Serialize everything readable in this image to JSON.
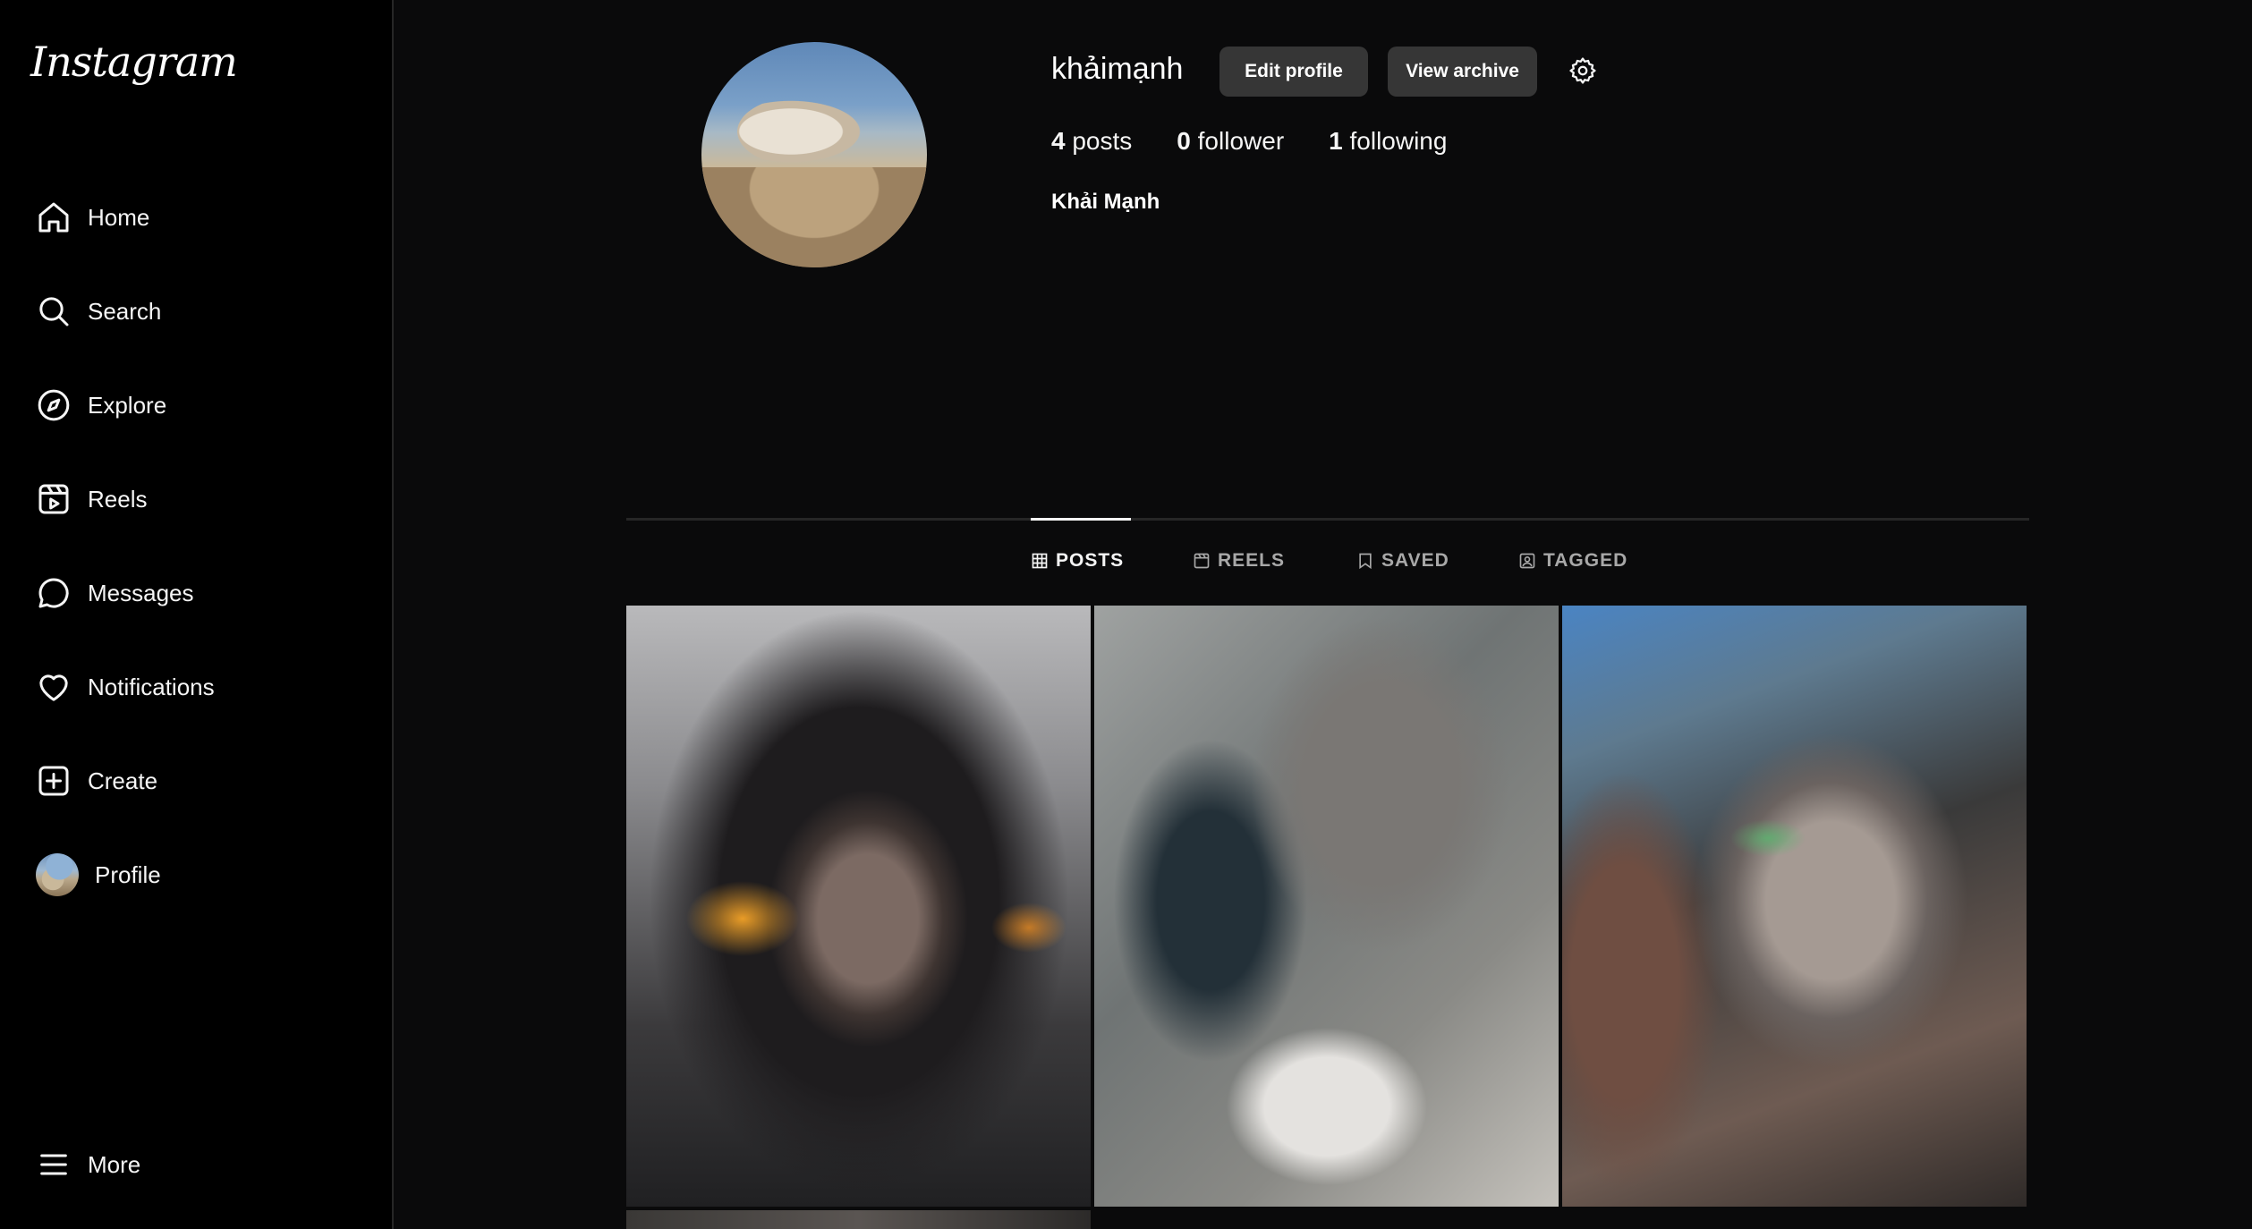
{
  "app": {
    "logo_text": "Instagram"
  },
  "sidebar": {
    "items": [
      {
        "label": "Home",
        "icon": "home-icon"
      },
      {
        "label": "Search",
        "icon": "search-icon"
      },
      {
        "label": "Explore",
        "icon": "compass-icon"
      },
      {
        "label": "Reels",
        "icon": "reels-icon"
      },
      {
        "label": "Messages",
        "icon": "message-icon"
      },
      {
        "label": "Notifications",
        "icon": "heart-icon"
      },
      {
        "label": "Create",
        "icon": "plus-square-icon"
      },
      {
        "label": "Profile",
        "icon": "avatar"
      }
    ],
    "more_label": "More"
  },
  "profile": {
    "username": "khảimạnh",
    "edit_label": "Edit profile",
    "archive_label": "View archive",
    "posts_count": "4",
    "posts_label": "posts",
    "followers_count": "0",
    "followers_label": "follower",
    "following_count": "1",
    "following_label": "following",
    "full_name": "Khải Mạnh"
  },
  "tabs": [
    {
      "label": "POSTS",
      "icon": "grid-icon",
      "active": true
    },
    {
      "label": "REELS",
      "icon": "reels-icon",
      "active": false
    },
    {
      "label": "SAVED",
      "icon": "bookmark-icon",
      "active": false
    },
    {
      "label": "TAGGED",
      "icon": "tag-icon",
      "active": false
    }
  ],
  "posts": [
    "hooded-girl-painting",
    "grey-haired-profile-painting",
    "archer-girl-painting",
    "partial-post"
  ],
  "colors": {
    "background": "#0a0a0b",
    "button": "#363636",
    "divider": "#262626",
    "text": "#f5f5f5",
    "muted": "#a8a8a8"
  }
}
